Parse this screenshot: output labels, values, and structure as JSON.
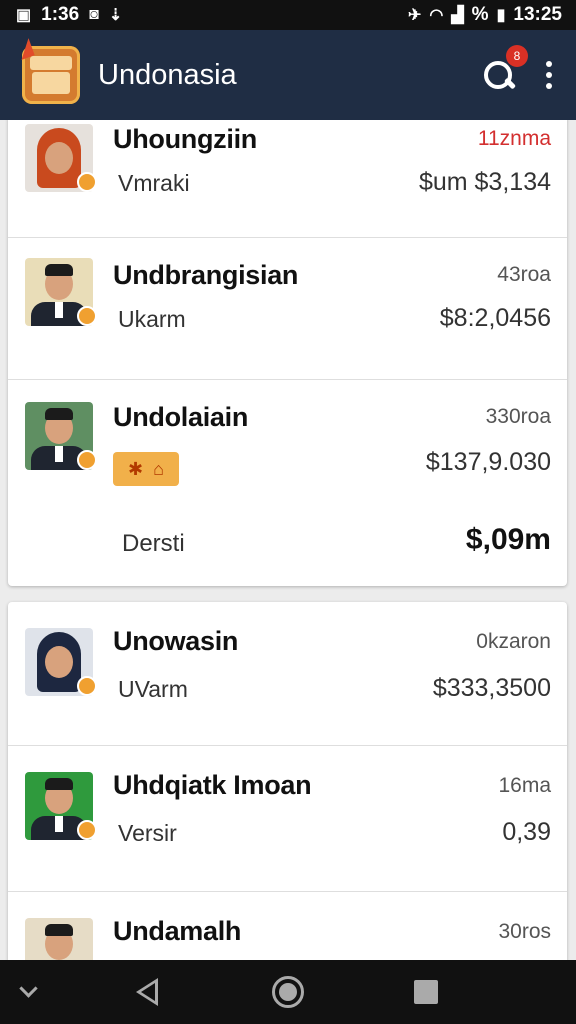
{
  "status_bar": {
    "left_time": "1:36",
    "right_time": "13:25",
    "battery_text": "%",
    "icons": [
      "image-icon",
      "usb-icon",
      "airplane-icon",
      "wifi-icon",
      "signal-icon",
      "battery-icon"
    ]
  },
  "app_bar": {
    "title": "Undonasia",
    "logo_icon": "treasure-box-icon",
    "notification_count": "8"
  },
  "contacts": [
    {
      "name": "Uhoungziin",
      "sub": "Vmraki",
      "time": "11znma",
      "amount": "$um $3,134",
      "time_color": "#d32f2f",
      "avatar": "woman-red-hijab"
    },
    {
      "name": "Undbrangisian",
      "sub": "Ukarm",
      "time": "43roa",
      "amount": "$8:2,0456",
      "avatar": "man-suit"
    },
    {
      "name": "Undolaiain",
      "sub": "",
      "time": "330roa",
      "amount": "$137,9.030",
      "avatar": "man-suit",
      "tag_icons": [
        "star-icon",
        "home-icon"
      ],
      "footer_label": "Dersti",
      "footer_amount": "$,09m"
    },
    {
      "name": "Unowasin",
      "sub": "UVarm",
      "time": "0kzaron",
      "amount": "$333,3500",
      "avatar": "woman-dark-hijab"
    },
    {
      "name": "Uhdqiatk Imoan",
      "sub": "Versir",
      "time": "16ma",
      "amount": "0,39",
      "avatar": "man-suit-green"
    },
    {
      "name": "Undamalh",
      "sub": "",
      "time": "30ros",
      "amount": "",
      "avatar": "man-suit"
    }
  ],
  "nav_bar": {
    "buttons": [
      "chevron-down-icon",
      "back-icon",
      "home-icon",
      "recents-icon"
    ]
  }
}
